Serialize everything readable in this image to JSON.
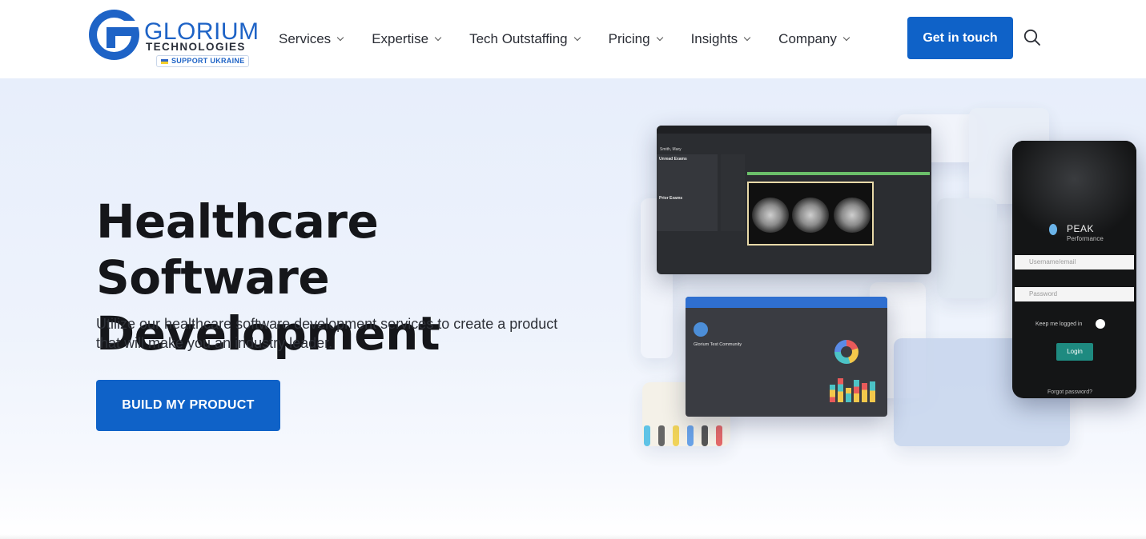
{
  "brand": {
    "name": "GLORIUM",
    "sub": "TECHNOLOGIES",
    "badge": "SUPPORT UKRAINE",
    "accent": "#1e63c6"
  },
  "nav": {
    "items": [
      {
        "label": "Services"
      },
      {
        "label": "Expertise"
      },
      {
        "label": "Tech Outstaffing"
      },
      {
        "label": "Pricing"
      },
      {
        "label": "Insights"
      },
      {
        "label": "Company"
      }
    ],
    "cta": "Get in touch",
    "search_icon": "search-icon"
  },
  "hero": {
    "title_line1": "Healthcare Software",
    "title_line2": "Development",
    "description": "Utilize our healthcare software development services to create a product that will make you an industry leader.",
    "cta": "BUILD MY PRODUCT"
  },
  "collage": {
    "radiology": {
      "patient": "Smith, Mary",
      "unread": "Unread Exams",
      "prior": "Prior Exams"
    },
    "dashboard": {
      "community": "Glorium Test Community"
    },
    "phone": {
      "app": "PEAK",
      "app_sub": "Performance",
      "username_placeholder": "Username/email",
      "password_placeholder": "Password",
      "keep_logged": "Keep me logged in",
      "login": "Login",
      "forgot": "Forgot password?"
    }
  }
}
